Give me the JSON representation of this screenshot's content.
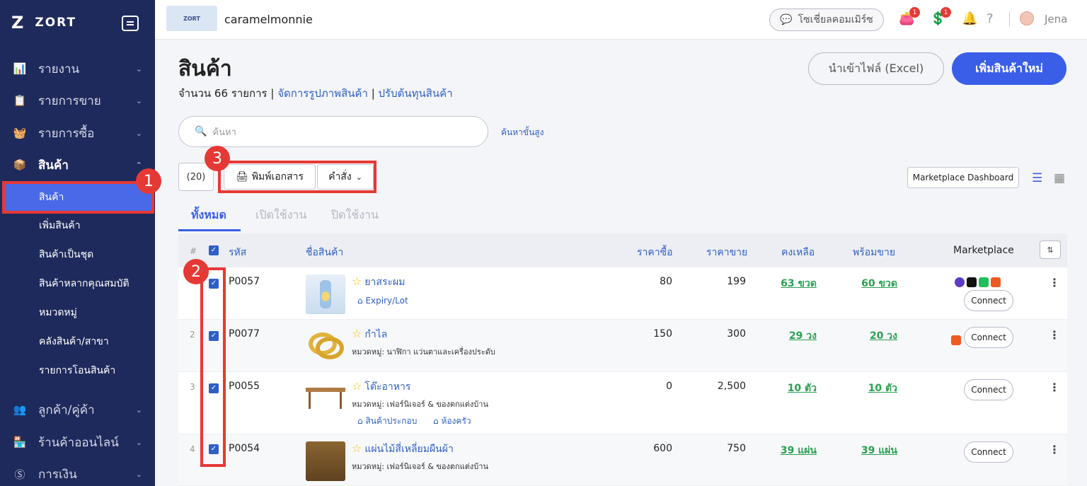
{
  "sidebar": {
    "brand": "ZORT",
    "items": [
      {
        "label": "รายงาน",
        "icon": "chart-icon"
      },
      {
        "label": "รายการขาย",
        "icon": "clipboard-icon"
      },
      {
        "label": "รายการซื้อ",
        "icon": "basket-icon"
      },
      {
        "label": "สินค้า",
        "icon": "box-icon"
      },
      {
        "label": "ลูกค้า/คู่ค้า",
        "icon": "people-icon"
      },
      {
        "label": "ร้านค้าออนไลน์",
        "icon": "store-icon"
      },
      {
        "label": "การเงิน",
        "icon": "money-icon"
      }
    ],
    "sub_items": [
      "สินค้า",
      "เพิ่มสินค้า",
      "สินค้าเป็นชุด",
      "สินค้าหลากคุณสมบัติ",
      "หมวดหมู่",
      "คลังสินค้า/สาขา",
      "รายการโอนสินค้า"
    ]
  },
  "markers": {
    "m1": "1",
    "m2": "2",
    "m3": "3"
  },
  "topbar": {
    "shop_name": "caramelmonnie",
    "social": "โซเชี่ยลคอมเมิร์ซ",
    "badge1": "1",
    "badge2": "1",
    "user": "Jena"
  },
  "page": {
    "title": "สินค้า",
    "count_text": "จำนวน 66 รายการ",
    "link1": "จัดการรูปภาพสินค้า",
    "link2": "ปรับต้นทุนสินค้า",
    "import_label": "นำเข้าไฟล์ (Excel)",
    "add_label": "เพิ่มสินค้าใหม่",
    "search_placeholder": "ค้นหา",
    "adv_search": "ค้นหาขั้นสูง",
    "selected_count": "(20)",
    "print_label": "พิมพ์เอกสาร",
    "command_label": "คำสั่ง",
    "marketplace_dashboard": "Marketplace Dashboard",
    "tabs": [
      "ทั้งหมด",
      "เปิดใช้งาน",
      "ปิดใช้งาน"
    ]
  },
  "table": {
    "headers": {
      "num": "#",
      "sku": "รหัส",
      "name": "ชื่อสินค้า",
      "buy": "ราคาซื้อ",
      "sell": "ราคาขาย",
      "stock": "คงเหลือ",
      "ready": "พร้อมขาย",
      "marketplace": "Marketplace"
    },
    "rows": [
      {
        "num": "",
        "sku": "P0057",
        "name": "ยาสระผม",
        "category": "",
        "tags": [
          "Expiry/Lot"
        ],
        "buy": "80",
        "sell": "199",
        "stock": "63 ขวด",
        "ready": "60 ขวด",
        "connect": "Connect"
      },
      {
        "num": "2",
        "sku": "P0077",
        "name": "กำไล",
        "category": "หมวดหมู่: นาฬิกา แว่นตาและเครื่องประดับ",
        "tags": [],
        "buy": "150",
        "sell": "300",
        "stock": "29 วง",
        "ready": "20 วง",
        "connect": "Connect"
      },
      {
        "num": "3",
        "sku": "P0055",
        "name": "โต๊ะอาหาร",
        "category": "หมวดหมู่: เฟอร์นิเจอร์ & ของตกแต่งบ้าน",
        "tags": [
          "สินค้าประกอบ",
          "ห้องครัว"
        ],
        "buy": "0",
        "sell": "2,500",
        "stock": "10 ตัว",
        "ready": "10 ตัว",
        "connect": "Connect"
      },
      {
        "num": "4",
        "sku": "P0054",
        "name": "แผ่นไม้สี่เหลี่ยมผืนผ้า",
        "category": "หมวดหมู่: เฟอร์นิเจอร์ & ของตกแต่งบ้าน",
        "tags": [],
        "buy": "600",
        "sell": "750",
        "stock": "39 แผ่น",
        "ready": "39 แผ่น",
        "connect": "Connect"
      }
    ]
  },
  "colors": {
    "sidebar": "#1f2a5c",
    "accent": "#3a5ee8",
    "highlight": "#e53935",
    "stock": "#2aa052"
  }
}
